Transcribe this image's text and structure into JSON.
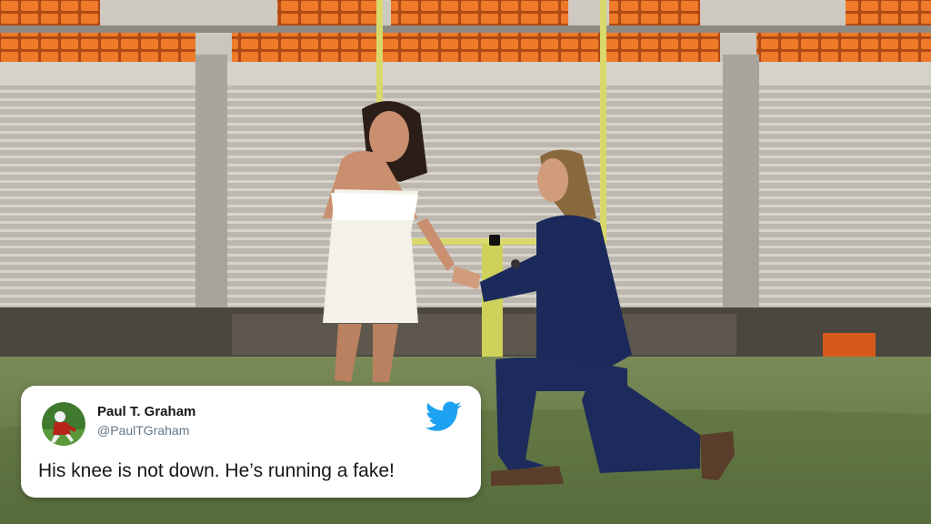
{
  "tweet": {
    "author_name": "Paul T. Graham",
    "author_handle": "@PaulTGraham",
    "text": "His knee is not down.  He’s running a fake!",
    "avatar_icon": "football-player-avatar",
    "brand_icon": "twitter-bird-icon",
    "brand_color": "#1da1f2"
  },
  "scene": {
    "description_icon": "stadium-proposal-photo",
    "colors": {
      "seats": "#e86a1f",
      "grass": "#5e7442",
      "goalpost": "#d8d96a",
      "suit": "#1b2a5a",
      "dress": "#f4f1ea"
    }
  }
}
